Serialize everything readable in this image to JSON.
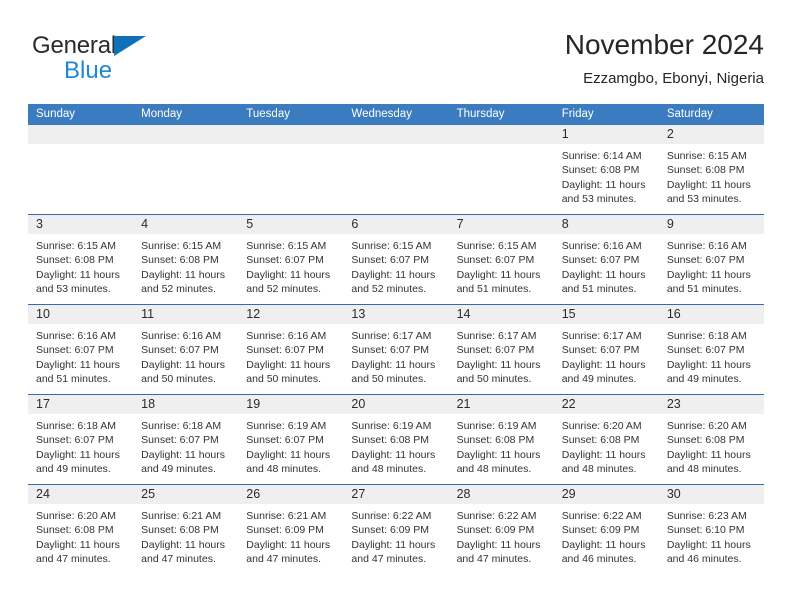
{
  "brand": {
    "name_part1": "General",
    "name_part2": "Blue"
  },
  "header": {
    "title": "November 2024",
    "subtitle": "Ezzamgbo, Ebonyi, Nigeria"
  },
  "colors": {
    "header_blue": "#3b7cc0",
    "row_divider": "#2f6fae",
    "daynum_band": "#efefef",
    "brand_blue": "#1f87d4",
    "logo_triangle": "#1171b8"
  },
  "weekdays": [
    "Sunday",
    "Monday",
    "Tuesday",
    "Wednesday",
    "Thursday",
    "Friday",
    "Saturday"
  ],
  "weeks": [
    [
      {
        "day": "",
        "sunrise": "",
        "sunset": "",
        "daylight_l1": "",
        "daylight_l2": ""
      },
      {
        "day": "",
        "sunrise": "",
        "sunset": "",
        "daylight_l1": "",
        "daylight_l2": ""
      },
      {
        "day": "",
        "sunrise": "",
        "sunset": "",
        "daylight_l1": "",
        "daylight_l2": ""
      },
      {
        "day": "",
        "sunrise": "",
        "sunset": "",
        "daylight_l1": "",
        "daylight_l2": ""
      },
      {
        "day": "",
        "sunrise": "",
        "sunset": "",
        "daylight_l1": "",
        "daylight_l2": ""
      },
      {
        "day": "1",
        "sunrise": "Sunrise: 6:14 AM",
        "sunset": "Sunset: 6:08 PM",
        "daylight_l1": "Daylight: 11 hours",
        "daylight_l2": "and 53 minutes."
      },
      {
        "day": "2",
        "sunrise": "Sunrise: 6:15 AM",
        "sunset": "Sunset: 6:08 PM",
        "daylight_l1": "Daylight: 11 hours",
        "daylight_l2": "and 53 minutes."
      }
    ],
    [
      {
        "day": "3",
        "sunrise": "Sunrise: 6:15 AM",
        "sunset": "Sunset: 6:08 PM",
        "daylight_l1": "Daylight: 11 hours",
        "daylight_l2": "and 53 minutes."
      },
      {
        "day": "4",
        "sunrise": "Sunrise: 6:15 AM",
        "sunset": "Sunset: 6:08 PM",
        "daylight_l1": "Daylight: 11 hours",
        "daylight_l2": "and 52 minutes."
      },
      {
        "day": "5",
        "sunrise": "Sunrise: 6:15 AM",
        "sunset": "Sunset: 6:07 PM",
        "daylight_l1": "Daylight: 11 hours",
        "daylight_l2": "and 52 minutes."
      },
      {
        "day": "6",
        "sunrise": "Sunrise: 6:15 AM",
        "sunset": "Sunset: 6:07 PM",
        "daylight_l1": "Daylight: 11 hours",
        "daylight_l2": "and 52 minutes."
      },
      {
        "day": "7",
        "sunrise": "Sunrise: 6:15 AM",
        "sunset": "Sunset: 6:07 PM",
        "daylight_l1": "Daylight: 11 hours",
        "daylight_l2": "and 51 minutes."
      },
      {
        "day": "8",
        "sunrise": "Sunrise: 6:16 AM",
        "sunset": "Sunset: 6:07 PM",
        "daylight_l1": "Daylight: 11 hours",
        "daylight_l2": "and 51 minutes."
      },
      {
        "day": "9",
        "sunrise": "Sunrise: 6:16 AM",
        "sunset": "Sunset: 6:07 PM",
        "daylight_l1": "Daylight: 11 hours",
        "daylight_l2": "and 51 minutes."
      }
    ],
    [
      {
        "day": "10",
        "sunrise": "Sunrise: 6:16 AM",
        "sunset": "Sunset: 6:07 PM",
        "daylight_l1": "Daylight: 11 hours",
        "daylight_l2": "and 51 minutes."
      },
      {
        "day": "11",
        "sunrise": "Sunrise: 6:16 AM",
        "sunset": "Sunset: 6:07 PM",
        "daylight_l1": "Daylight: 11 hours",
        "daylight_l2": "and 50 minutes."
      },
      {
        "day": "12",
        "sunrise": "Sunrise: 6:16 AM",
        "sunset": "Sunset: 6:07 PM",
        "daylight_l1": "Daylight: 11 hours",
        "daylight_l2": "and 50 minutes."
      },
      {
        "day": "13",
        "sunrise": "Sunrise: 6:17 AM",
        "sunset": "Sunset: 6:07 PM",
        "daylight_l1": "Daylight: 11 hours",
        "daylight_l2": "and 50 minutes."
      },
      {
        "day": "14",
        "sunrise": "Sunrise: 6:17 AM",
        "sunset": "Sunset: 6:07 PM",
        "daylight_l1": "Daylight: 11 hours",
        "daylight_l2": "and 50 minutes."
      },
      {
        "day": "15",
        "sunrise": "Sunrise: 6:17 AM",
        "sunset": "Sunset: 6:07 PM",
        "daylight_l1": "Daylight: 11 hours",
        "daylight_l2": "and 49 minutes."
      },
      {
        "day": "16",
        "sunrise": "Sunrise: 6:18 AM",
        "sunset": "Sunset: 6:07 PM",
        "daylight_l1": "Daylight: 11 hours",
        "daylight_l2": "and 49 minutes."
      }
    ],
    [
      {
        "day": "17",
        "sunrise": "Sunrise: 6:18 AM",
        "sunset": "Sunset: 6:07 PM",
        "daylight_l1": "Daylight: 11 hours",
        "daylight_l2": "and 49 minutes."
      },
      {
        "day": "18",
        "sunrise": "Sunrise: 6:18 AM",
        "sunset": "Sunset: 6:07 PM",
        "daylight_l1": "Daylight: 11 hours",
        "daylight_l2": "and 49 minutes."
      },
      {
        "day": "19",
        "sunrise": "Sunrise: 6:19 AM",
        "sunset": "Sunset: 6:07 PM",
        "daylight_l1": "Daylight: 11 hours",
        "daylight_l2": "and 48 minutes."
      },
      {
        "day": "20",
        "sunrise": "Sunrise: 6:19 AM",
        "sunset": "Sunset: 6:08 PM",
        "daylight_l1": "Daylight: 11 hours",
        "daylight_l2": "and 48 minutes."
      },
      {
        "day": "21",
        "sunrise": "Sunrise: 6:19 AM",
        "sunset": "Sunset: 6:08 PM",
        "daylight_l1": "Daylight: 11 hours",
        "daylight_l2": "and 48 minutes."
      },
      {
        "day": "22",
        "sunrise": "Sunrise: 6:20 AM",
        "sunset": "Sunset: 6:08 PM",
        "daylight_l1": "Daylight: 11 hours",
        "daylight_l2": "and 48 minutes."
      },
      {
        "day": "23",
        "sunrise": "Sunrise: 6:20 AM",
        "sunset": "Sunset: 6:08 PM",
        "daylight_l1": "Daylight: 11 hours",
        "daylight_l2": "and 48 minutes."
      }
    ],
    [
      {
        "day": "24",
        "sunrise": "Sunrise: 6:20 AM",
        "sunset": "Sunset: 6:08 PM",
        "daylight_l1": "Daylight: 11 hours",
        "daylight_l2": "and 47 minutes."
      },
      {
        "day": "25",
        "sunrise": "Sunrise: 6:21 AM",
        "sunset": "Sunset: 6:08 PM",
        "daylight_l1": "Daylight: 11 hours",
        "daylight_l2": "and 47 minutes."
      },
      {
        "day": "26",
        "sunrise": "Sunrise: 6:21 AM",
        "sunset": "Sunset: 6:09 PM",
        "daylight_l1": "Daylight: 11 hours",
        "daylight_l2": "and 47 minutes."
      },
      {
        "day": "27",
        "sunrise": "Sunrise: 6:22 AM",
        "sunset": "Sunset: 6:09 PM",
        "daylight_l1": "Daylight: 11 hours",
        "daylight_l2": "and 47 minutes."
      },
      {
        "day": "28",
        "sunrise": "Sunrise: 6:22 AM",
        "sunset": "Sunset: 6:09 PM",
        "daylight_l1": "Daylight: 11 hours",
        "daylight_l2": "and 47 minutes."
      },
      {
        "day": "29",
        "sunrise": "Sunrise: 6:22 AM",
        "sunset": "Sunset: 6:09 PM",
        "daylight_l1": "Daylight: 11 hours",
        "daylight_l2": "and 46 minutes."
      },
      {
        "day": "30",
        "sunrise": "Sunrise: 6:23 AM",
        "sunset": "Sunset: 6:10 PM",
        "daylight_l1": "Daylight: 11 hours",
        "daylight_l2": "and 46 minutes."
      }
    ]
  ]
}
